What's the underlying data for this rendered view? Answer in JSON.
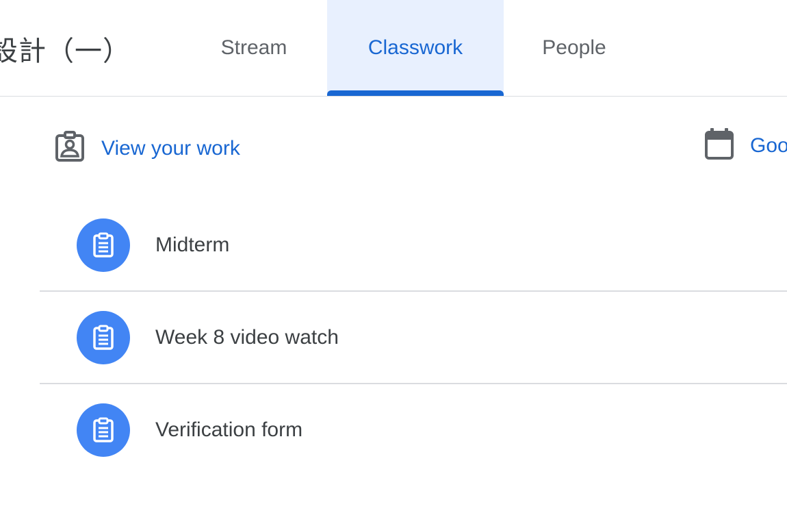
{
  "header": {
    "class_title": "設計（一）",
    "tabs": [
      {
        "label": "Stream"
      },
      {
        "label": "Classwork"
      },
      {
        "label": "People"
      }
    ]
  },
  "toolbar": {
    "view_work_label": "View your work",
    "calendar_label": "Goo"
  },
  "classwork": {
    "items": [
      {
        "title": "Midterm",
        "icon": "assignment-icon"
      },
      {
        "title": "Week 8 video watch",
        "icon": "assignment-icon"
      },
      {
        "title": "Verification form",
        "icon": "assignment-icon"
      }
    ]
  },
  "colors": {
    "accent": "#1967d2",
    "active_tab_bg": "#e8f0fe",
    "assignment_circle": "#4285f4",
    "text_primary": "#3c4043",
    "text_secondary": "#5f6368",
    "divider": "#dadce0"
  }
}
